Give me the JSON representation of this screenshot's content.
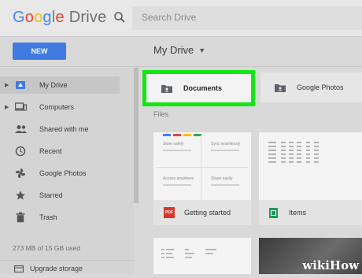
{
  "header": {
    "logo_google_letters": [
      {
        "ch": "G",
        "color": "#4285f4"
      },
      {
        "ch": "o",
        "color": "#ea4335"
      },
      {
        "ch": "o",
        "color": "#fbbc05"
      },
      {
        "ch": "g",
        "color": "#4285f4"
      },
      {
        "ch": "l",
        "color": "#34a853"
      },
      {
        "ch": "e",
        "color": "#ea4335"
      }
    ],
    "logo_drive": "Drive",
    "search_placeholder": "Search Drive",
    "search_icon": "search-icon"
  },
  "toolbar": {
    "new_label": "NEW",
    "location_label": "My Drive",
    "location_caret": "▼"
  },
  "sidebar": {
    "items": [
      {
        "label": "My Drive",
        "icon": "drive-icon",
        "active": true,
        "expandable": true
      },
      {
        "label": "Computers",
        "icon": "computers-icon",
        "active": false,
        "expandable": true
      },
      {
        "label": "Shared with me",
        "icon": "people-icon",
        "active": false,
        "expandable": false
      },
      {
        "label": "Recent",
        "icon": "clock-icon",
        "active": false,
        "expandable": false
      },
      {
        "label": "Google Photos",
        "icon": "pinwheel-icon",
        "active": false,
        "expandable": false
      },
      {
        "label": "Starred",
        "icon": "star-icon",
        "active": false,
        "expandable": false
      },
      {
        "label": "Trash",
        "icon": "trash-icon",
        "active": false,
        "expandable": false
      }
    ],
    "storage_text": "273 MB of 15 GB used",
    "upgrade_label": "Upgrade storage"
  },
  "main": {
    "folders": [
      {
        "name": "Documents",
        "highlighted": true,
        "icon": "shared-folder-icon"
      },
      {
        "name": "Google Photos",
        "highlighted": false,
        "icon": "shared-folder-icon"
      }
    ],
    "files_heading": "Files",
    "files": [
      {
        "name": "Getting started",
        "icon": "pdf-icon",
        "icon_text": "PDF",
        "thumb_quadrants": [
          "Store safely",
          "Sync seamlessly",
          "Access anywhere",
          "Share easily"
        ]
      },
      {
        "name": "Items",
        "icon": "sheets-icon"
      }
    ]
  },
  "watermark": "wikiHow",
  "colors": {
    "new_button": "#3f7be0",
    "highlight": "#14e614",
    "pdf": "#d9382c",
    "sheets": "#1d9a57"
  }
}
